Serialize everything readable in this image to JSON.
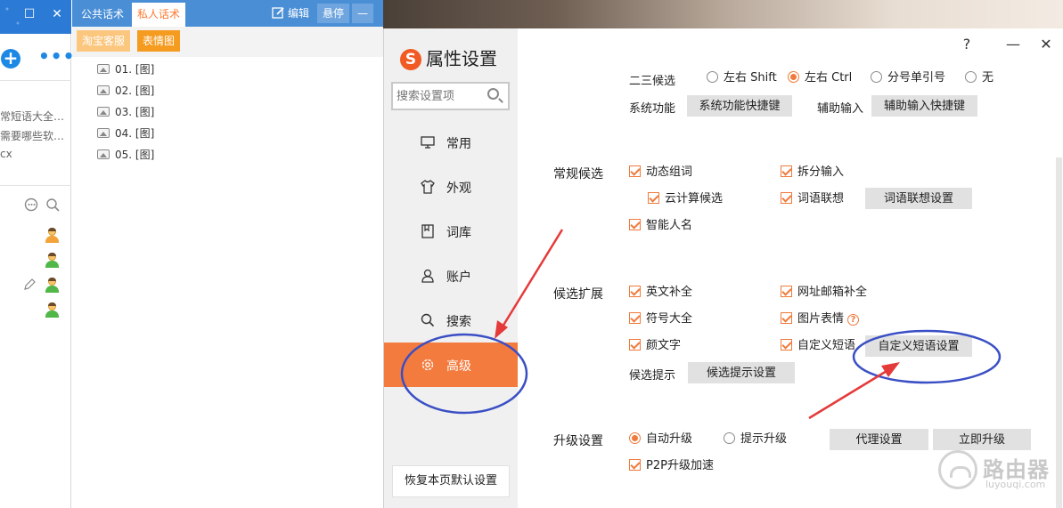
{
  "left_panel": {
    "window_buttons": [
      "☐",
      "✕"
    ],
    "add_icon": "+",
    "more_icon": "•••",
    "snippets": [
      "常短语大全…",
      "需要哪些软…",
      "cx"
    ],
    "icon_names": [
      "chat-bubble-icon",
      "search-icon",
      "pen-icon",
      "contact-avatar-icon"
    ]
  },
  "mid_panel": {
    "tabs": [
      {
        "label": "公共话术",
        "active": false
      },
      {
        "label": "私人话术",
        "active": true
      }
    ],
    "tools": {
      "edit": "编辑",
      "float": "悬停",
      "minimize": "—"
    },
    "tag_buttons": [
      {
        "label": "淘宝客服",
        "color": "#fbc77f"
      },
      {
        "label": "表情图",
        "color": "#f59b1f"
      }
    ],
    "phrases": [
      "01. [图]",
      "02. [图]",
      "03. [图]",
      "04. [图]",
      "05. [图]"
    ]
  },
  "dialog": {
    "title": "属性设置",
    "logo": "S",
    "controls": {
      "help": "?",
      "minimize": "—",
      "close": "✕"
    },
    "search_placeholder": "搜索设置项",
    "nav": [
      {
        "label": "常用",
        "icon": "monitor-icon",
        "active": false
      },
      {
        "label": "外观",
        "icon": "shirt-icon",
        "active": false
      },
      {
        "label": "词库",
        "icon": "book-icon",
        "active": false
      },
      {
        "label": "账户",
        "icon": "user-icon",
        "active": false
      },
      {
        "label": "搜索",
        "icon": "search-icon",
        "active": false
      },
      {
        "label": "高级",
        "icon": "gear-icon",
        "active": true
      }
    ],
    "restore_default": "恢复本页默认设置",
    "accent_color": "#f47b3e",
    "content": {
      "row_23": {
        "label": "二三候选",
        "options": [
          {
            "label": "左右 Shift",
            "checked": false
          },
          {
            "label": "左右 Ctrl",
            "checked": true
          },
          {
            "label": "分号单引号",
            "checked": false
          },
          {
            "label": "无",
            "checked": false
          }
        ]
      },
      "system_function": {
        "label": "系统功能",
        "button": "系统功能快捷键"
      },
      "aux_input": {
        "label": "辅助输入",
        "button": "辅助输入快捷键"
      },
      "regular": {
        "label": "常规候选",
        "items": {
          "dynamic_words": "动态组词",
          "split_input": "拆分输入",
          "cloud": "云计算候选",
          "word_assoc": "词语联想",
          "smart_name": "智能人名"
        },
        "word_assoc_button": "词语联想设置"
      },
      "extension": {
        "label": "候选扩展",
        "items": {
          "english": "英文补全",
          "url_email": "网址邮箱补全",
          "symbols": "符号大全",
          "image_emoji": "图片表情",
          "kaomoji": "颜文字",
          "custom_phrase": "自定义短语"
        },
        "help_icon": "?",
        "custom_phrase_button": "自定义短语设置",
        "hint_label": "候选提示",
        "hint_button": "候选提示设置"
      },
      "upgrade": {
        "label": "升级设置",
        "auto": {
          "label": "自动升级",
          "checked": true
        },
        "prompt": {
          "label": "提示升级",
          "checked": false
        },
        "proxy_button": "代理设置",
        "upgrade_now_button": "立即升级",
        "p2p": "P2P升级加速"
      }
    }
  },
  "watermark": {
    "name": "路由器",
    "url": "luyouqi.com"
  }
}
